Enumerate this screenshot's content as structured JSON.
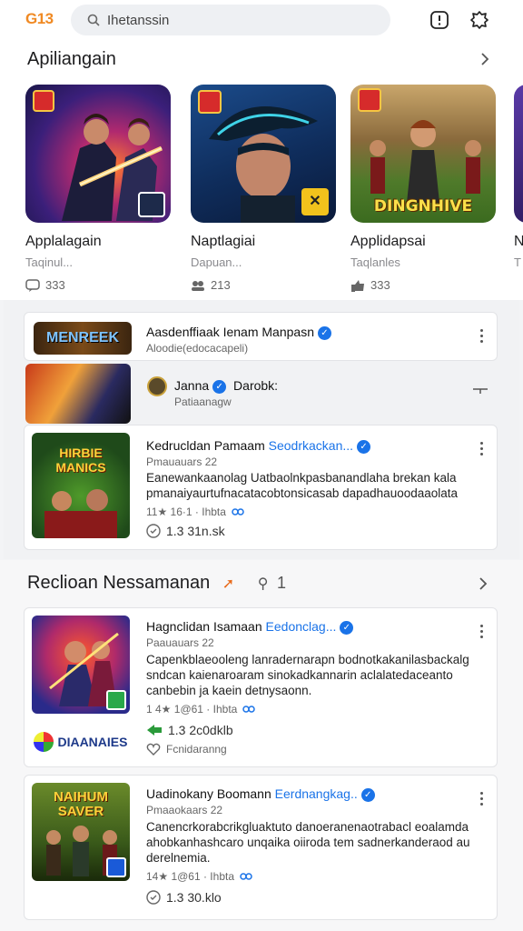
{
  "header": {
    "logo": "G13",
    "search_text": "Ihetanssin"
  },
  "section1": {
    "title": "Apiliangain",
    "apps": [
      {
        "name": "Applalagain",
        "sub": "Taqinul...",
        "count": "333"
      },
      {
        "name": "Naptlagiai",
        "sub": "Dapuan...",
        "count": "213"
      },
      {
        "name": "Applidapsai",
        "sub": "Taqlanles",
        "count": "333"
      },
      {
        "name": "N",
        "sub": "T",
        "count": ""
      }
    ],
    "badge_labels": [
      "DINGNHIVE"
    ]
  },
  "list": {
    "row1": {
      "thumb_text": "MENREEK",
      "title": "Aasdenffiaak Ienam Manpasn",
      "sub": "Aloodie(edocacapeli)"
    },
    "row2": {
      "title": "Janna",
      "title2": "Darobk:",
      "sub": "Patiaanagw"
    },
    "row3": {
      "thumb_text": "HIRBIE MANICS",
      "title": "Kedrucldan Pamaam",
      "title_blue": "Seodrkackan...",
      "sub": "Pmauauars 22",
      "desc": "Eanewankaanolag Uatbaolnkpasbanandlaha brekan kala pmanaiyaurtufnacatacobtonsicasab dapadhauoodaaolata",
      "rating": "11★ 16·1 · Ihbta",
      "stat": "1.3 31n.sk"
    }
  },
  "section2": {
    "title": "Reclioan Nessamanan",
    "tag": "1",
    "items": [
      {
        "title": "Hagnclidan Isamaan",
        "title_blue": "Eedonclag...",
        "sub": "Paauauars 22",
        "desc": "Capenkblaeooleng lanradernarapn bodnotkakanilasbackalg sndcan kaienaroaram sinokadkannarin aclalatedaceanto canbebin ja kaein detnysaonn.",
        "rating": "1 4★ 1@61 · Ihbta",
        "stat": "1.3 2c0dklb",
        "stat2": "Fcnidaranng",
        "extra_logo": "DIAANAIES"
      },
      {
        "title": "Uadinokany Boomann",
        "title_blue": "Eerdnangkag..",
        "sub": "Pmaaokaars 22",
        "desc": "Canencrkorabcrikgluaktuto danoeranenaotrabacl eoalamda ahobkanhashcaro unqaika oiiroda tem sadnerkanderaod au derelnemia.",
        "rating": "14★ 1@61 · Ihbta",
        "stat": "1.3 30.klo",
        "thumb_text": "NAIHUM SAVER"
      }
    ]
  },
  "colors": {
    "accent": "#1a73e8",
    "logo": "#f08a24"
  }
}
